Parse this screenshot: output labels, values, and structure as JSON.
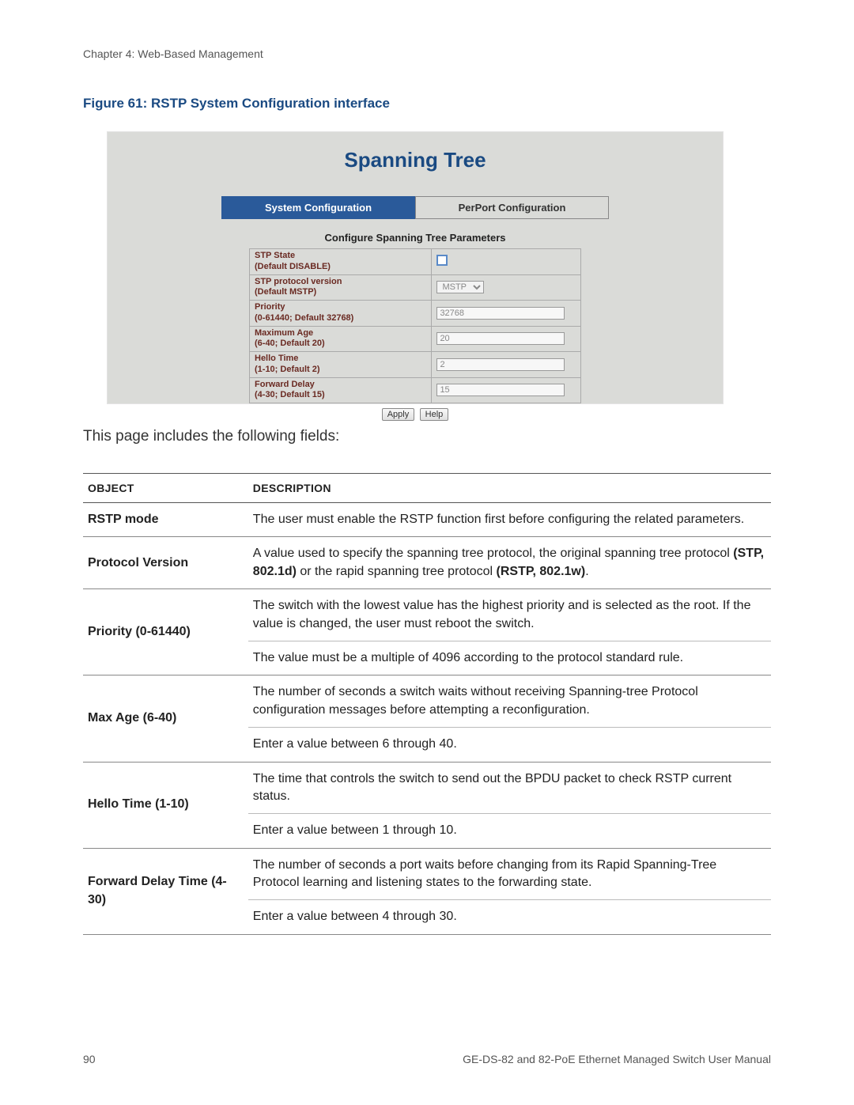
{
  "header": "Chapter 4: Web-Based Management",
  "figure_caption": "Figure 61: RSTP System Configuration interface",
  "screenshot": {
    "title": "Spanning Tree",
    "tab_active": "System Configuration",
    "tab_inactive": "PerPort Configuration",
    "section_header": "Configure Spanning Tree Parameters",
    "rows": [
      {
        "label_line1": "STP State",
        "label_line2": "(Default DISABLE)",
        "type": "check"
      },
      {
        "label_line1": "STP protocol version",
        "label_line2": "(Default MSTP)",
        "type": "select",
        "value": "MSTP"
      },
      {
        "label_line1": "Priority",
        "label_line2": "(0-61440; Default 32768)",
        "type": "text",
        "value": "32768"
      },
      {
        "label_line1": "Maximum Age",
        "label_line2": "(6-40; Default 20)",
        "type": "text",
        "value": "20"
      },
      {
        "label_line1": "Hello Time",
        "label_line2": "(1-10; Default 2)",
        "type": "text",
        "value": "2"
      },
      {
        "label_line1": "Forward Delay",
        "label_line2": "(4-30; Default 15)",
        "type": "text",
        "value": "15"
      }
    ],
    "buttons": {
      "apply": "Apply",
      "help": "Help"
    }
  },
  "intro": "This page includes the following fields:",
  "table": {
    "head_object": "OBJECT",
    "head_desc": "DESCRIPTION",
    "rows": {
      "rstp_mode": {
        "object": "RSTP mode",
        "desc": "The user must enable the RSTP function first before configuring the related parameters."
      },
      "protocol_version": {
        "object": "Protocol Version",
        "desc_pre": "A value used to specify the spanning tree protocol, the original spanning tree protocol ",
        "bold1": "(STP, 802.1d)",
        "desc_mid": " or the rapid spanning tree protocol ",
        "bold2": "(RSTP, 802.1w)",
        "desc_post": "."
      },
      "priority": {
        "object": "Priority (0-61440)",
        "desc1": "The switch with the lowest value has the highest priority and is selected as the root. If the value is changed, the user must reboot the switch.",
        "desc2": "The value must be a multiple of 4096 according to the protocol standard rule."
      },
      "max_age": {
        "object": "Max Age (6-40)",
        "desc1": "The number of seconds a switch waits without receiving Spanning-tree Protocol configuration messages before attempting a reconfiguration.",
        "desc2": "Enter a value between 6 through 40."
      },
      "hello_time": {
        "object": "Hello Time (1-10)",
        "desc1": "The time that controls the switch to send out the BPDU packet to check RSTP current status.",
        "desc2": "Enter a value between 1 through 10."
      },
      "forward_delay": {
        "object": "Forward Delay Time (4-30)",
        "desc1": "The number of seconds a port waits before changing from its Rapid Spanning-Tree Protocol learning and listening states to the forwarding state.",
        "desc2": "Enter a value between 4 through 30."
      }
    }
  },
  "footer": {
    "page_num": "90",
    "manual": "GE-DS-82 and 82-PoE Ethernet Managed Switch User Manual"
  }
}
